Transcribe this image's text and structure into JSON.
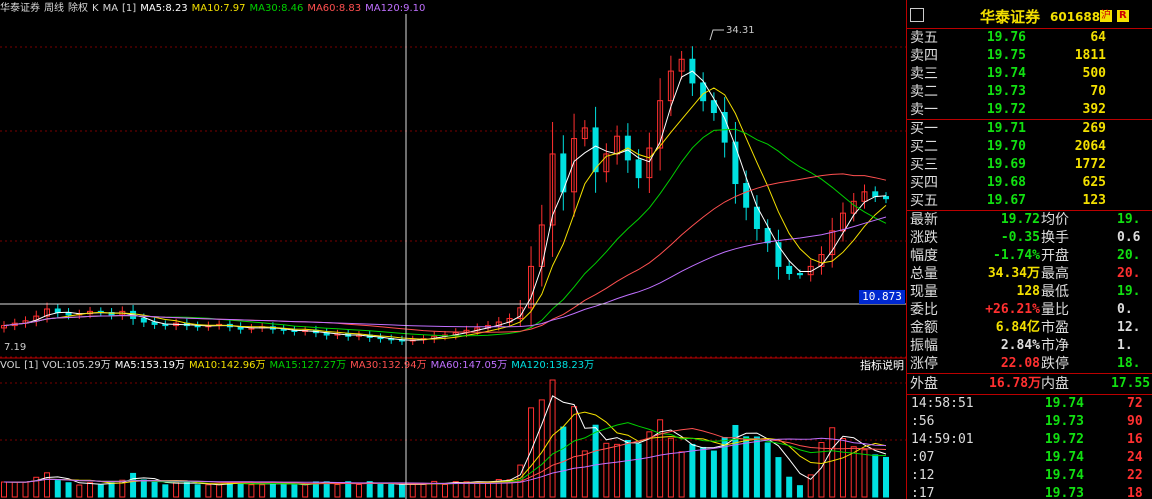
{
  "chart_header": {
    "name": "华泰证券",
    "period": "周线",
    "adjust": "除权",
    "type": "K",
    "ind": "MA",
    "param": "[1]",
    "ma5": "MA5:8.23",
    "ma10": "MA10:7.97",
    "ma30": "MA30:8.46",
    "ma60": "MA60:8.83",
    "ma120": "MA120:9.10"
  },
  "vol_header": {
    "vol": "VOL",
    "param": "[1]",
    "vol_val": "VOL:105.29万",
    "ma5": "MA5:153.19万",
    "ma10": "MA10:142.96万",
    "ma15": "MA15:127.27万",
    "ma30": "MA30:132.94万",
    "ma60": "MA60:147.05万",
    "ma120": "MA120:138.23万"
  },
  "index_button": "指标说明",
  "high_label": "34.31",
  "low_label": "7.19",
  "cursor_price": "10.873",
  "quote": {
    "name": "华泰证券",
    "code": "601688",
    "tag_market": "沪",
    "tag_r": "R",
    "asks": [
      {
        "label": "卖五",
        "price": "19.76",
        "vol": "64"
      },
      {
        "label": "卖四",
        "price": "19.75",
        "vol": "1811"
      },
      {
        "label": "卖三",
        "price": "19.74",
        "vol": "500"
      },
      {
        "label": "卖二",
        "price": "19.73",
        "vol": "70"
      },
      {
        "label": "卖一",
        "price": "19.72",
        "vol": "392"
      }
    ],
    "bids": [
      {
        "label": "买一",
        "price": "19.71",
        "vol": "269"
      },
      {
        "label": "买二",
        "price": "19.70",
        "vol": "2064"
      },
      {
        "label": "买三",
        "price": "19.69",
        "vol": "1772"
      },
      {
        "label": "买四",
        "price": "19.68",
        "vol": "625"
      },
      {
        "label": "买五",
        "price": "19.67",
        "vol": "123"
      }
    ],
    "stats": [
      {
        "l1": "最新",
        "v1": "19.72",
        "c1": "g",
        "l2": "均价",
        "v2": "19.",
        "c2": "g"
      },
      {
        "l1": "涨跌",
        "v1": "-0.35",
        "c1": "g",
        "l2": "换手",
        "v2": "0.6",
        "c2": "wt"
      },
      {
        "l1": "幅度",
        "v1": "-1.74%",
        "c1": "g",
        "l2": "开盘",
        "v2": "20.",
        "c2": "g"
      },
      {
        "l1": "总量",
        "v1": "34.34万",
        "c1": "yy",
        "l2": "最高",
        "v2": "20.",
        "c2": "r"
      },
      {
        "l1": "现量",
        "v1": "128",
        "c1": "yy",
        "l2": "最低",
        "v2": "19.",
        "c2": "g"
      },
      {
        "l1": "委比",
        "v1": "+26.21%",
        "c1": "r",
        "l2": "量比",
        "v2": "0.",
        "c2": "wt"
      },
      {
        "l1": "金额",
        "v1": "6.84亿",
        "c1": "yy",
        "l2": "市盈",
        "v2": "12.",
        "c2": "wt"
      },
      {
        "l1": "振幅",
        "v1": "2.84%",
        "c1": "wt",
        "l2": "市净",
        "v2": "1.",
        "c2": "wt"
      },
      {
        "l1": "涨停",
        "v1": "22.08",
        "c1": "r",
        "l2": "跌停",
        "v2": "18.",
        "c2": "g"
      }
    ],
    "outer": {
      "label": "外盘",
      "value": "16.78万",
      "label2": "内盘",
      "value2": "17.55"
    },
    "ticks": [
      {
        "t": "14:58:51",
        "p": "19.74",
        "v": "72"
      },
      {
        "t": ":56",
        "p": "19.73",
        "v": "90"
      },
      {
        "t": "14:59:01",
        "p": "19.72",
        "v": "16"
      },
      {
        "t": ":07",
        "p": "19.74",
        "v": "24"
      },
      {
        "t": ":12",
        "p": "19.74",
        "v": "22"
      },
      {
        "t": ":17",
        "p": "19.73",
        "v": "18"
      }
    ]
  },
  "colors": {
    "up": "#ff3030",
    "down": "#00e0e0",
    "ma5": "#ffffff",
    "ma10": "#f3e000",
    "ma30": "#00d000",
    "ma60": "#ff5050",
    "ma120": "#c070ff",
    "panel_border": "#bb0000"
  },
  "chart_data": {
    "type": "candlestick",
    "y_unit": "price",
    "high": 34.31,
    "low": 7.19,
    "closes": [
      9.0,
      9.2,
      9.4,
      9.8,
      10.4,
      10.1,
      9.9,
      10.0,
      10.2,
      10.1,
      9.9,
      10.2,
      9.6,
      9.3,
      9.1,
      9.0,
      9.2,
      9.0,
      8.9,
      9.0,
      9.1,
      8.9,
      8.7,
      8.8,
      8.9,
      8.7,
      8.6,
      8.5,
      8.6,
      8.4,
      8.2,
      8.3,
      8.1,
      8.2,
      8.0,
      7.9,
      7.8,
      7.7,
      7.8,
      7.9,
      8.1,
      8.2,
      8.4,
      8.6,
      8.8,
      9.0,
      9.3,
      9.6,
      10.5,
      14.0,
      17.5,
      23.5,
      20.3,
      24.8,
      25.7,
      22.0,
      23.5,
      25.0,
      23.0,
      21.5,
      24.0,
      28.0,
      30.5,
      31.5,
      29.5,
      28.0,
      27.0,
      24.5,
      21.0,
      19.0,
      17.2,
      16.0,
      14.0,
      13.4,
      13.3,
      14.0,
      15.0,
      17.0,
      18.5,
      19.5,
      20.3,
      19.9,
      19.72
    ]
  }
}
